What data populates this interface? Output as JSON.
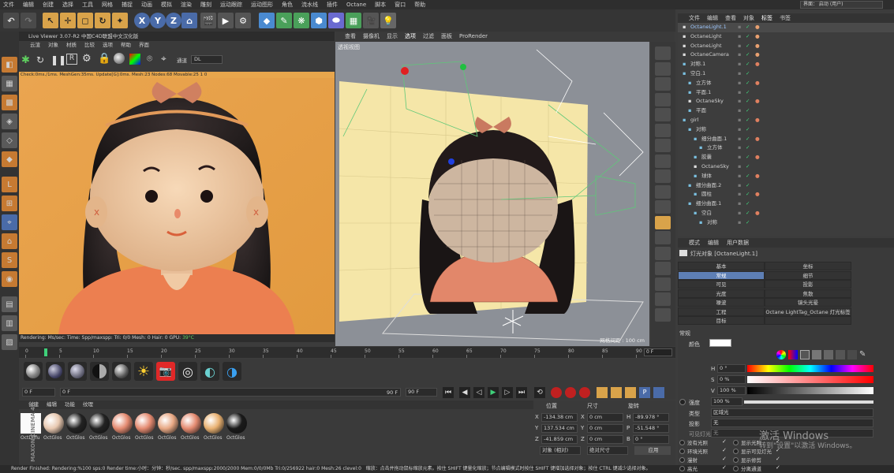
{
  "menu": [
    "文件",
    "编辑",
    "创建",
    "选择",
    "工具",
    "网格",
    "捕捉",
    "动画",
    "模拟",
    "渲染",
    "雕刻",
    "运动跟踪",
    "运动图形",
    "角色",
    "流水线",
    "插件",
    "Octane",
    "脚本",
    "窗口",
    "帮助"
  ],
  "layout_label": "界面：  启动 (用户)",
  "toolbar": {
    "x": "X",
    "y": "Y",
    "z": "Z"
  },
  "live_viewer": {
    "title": "Live Viewer 3.07-R2 中国C4D联盟中文汉化版",
    "menu": [
      "云渲",
      "对象",
      "材质",
      "比较",
      "选项",
      "帮助",
      "界面"
    ],
    "channel_label": "通道",
    "channel_value": "DL",
    "stats": "Check:0ms./1ms. MeshGen:35ms. Update[G]:0ms. Mesh:23 Nodes:68 Movable:25 1 0",
    "status": "Rendering:    Ms/sec:     Time:      Spp/maxspp:      Tri: 0/0  Mesh: 0    Hair: 0    GPU:",
    "gpu_temp": "39°C"
  },
  "viewport": {
    "menu": [
      "查看",
      "摄像机",
      "显示",
      "选项",
      "过滤",
      "面板",
      "ProRender"
    ],
    "label": "透视视图",
    "grid_spacing": "网格间距 : 100 cm"
  },
  "timeline": {
    "ticks": [
      "0",
      "5",
      "10",
      "15",
      "20",
      "25",
      "30",
      "35",
      "40",
      "45",
      "50",
      "55",
      "60",
      "65",
      "70",
      "75",
      "80",
      "85",
      "90"
    ],
    "end_frame": "0 F"
  },
  "controls": {
    "start": "0 F",
    "current": "0 F",
    "end": "90 F",
    "end2": "90 F"
  },
  "material_panel": {
    "tabs": [
      "创建",
      "编辑",
      "功能",
      "纹理"
    ],
    "materials": [
      "OctDiffu",
      "OctGlos",
      "OctGlos",
      "OctGlos",
      "OctGlos",
      "OctGlos",
      "OctGlos",
      "OctGlos",
      "OctGlos",
      "OctGlos"
    ],
    "brand1": "MAXON",
    "brand2": "CINEMA 4D"
  },
  "coords": {
    "headers": [
      "位置",
      "尺寸",
      "旋转"
    ],
    "rows": [
      [
        "X",
        "-134.38 cm",
        "X",
        "0 cm",
        "H",
        "-89.978 °"
      ],
      [
        "Y",
        "137.534 cm",
        "Y",
        "0 cm",
        "P",
        "-51.548 °"
      ],
      [
        "Z",
        "-41.859 cm",
        "Z",
        "0 cm",
        "B",
        "0 °"
      ]
    ],
    "obj_mode": "对象 (相对)",
    "size_mode": "绝对尺寸",
    "apply": "应用"
  },
  "object_tabs": [
    "文件",
    "编辑",
    "查看",
    "对象",
    "标签",
    "书签"
  ],
  "objects": [
    {
      "name": "OctaneLight.1",
      "indent": 0,
      "sel": true
    },
    {
      "name": "OctaneLight",
      "indent": 0
    },
    {
      "name": "OctaneLight",
      "indent": 0
    },
    {
      "name": "OctaneCamera",
      "indent": 0
    },
    {
      "name": "对称.1",
      "indent": 0
    },
    {
      "name": "空白.1",
      "indent": 0
    },
    {
      "name": "立方体",
      "indent": 1
    },
    {
      "name": "平面.1",
      "indent": 1
    },
    {
      "name": "OctaneSky",
      "indent": 1
    },
    {
      "name": "平面",
      "indent": 1
    },
    {
      "name": "girl",
      "indent": 0
    },
    {
      "name": "对称",
      "indent": 1
    },
    {
      "name": "细分曲面.1",
      "indent": 2
    },
    {
      "name": "立方体",
      "indent": 3
    },
    {
      "name": "胶囊",
      "indent": 2
    },
    {
      "name": "OctaneSky",
      "indent": 2
    },
    {
      "name": "球体",
      "indent": 2
    },
    {
      "name": "细分曲面.2",
      "indent": 1
    },
    {
      "name": "圆柱",
      "indent": 2
    },
    {
      "name": "细分曲面.1",
      "indent": 1
    },
    {
      "name": "空白",
      "indent": 2
    },
    {
      "name": "对称",
      "indent": 3
    }
  ],
  "attr_tabs": [
    "模式",
    "编辑",
    "用户数据"
  ],
  "attr_title": "灯光对象 [OctaneLight.1]",
  "attr_grid": [
    [
      "基本",
      "坐标"
    ],
    [
      "常规",
      "细节"
    ],
    [
      "可见",
      "投影"
    ],
    [
      "光度",
      "焦散"
    ],
    [
      "噪波",
      "镜头光晕"
    ],
    [
      "工程",
      "Octane LightTag_Octane 灯光标签"
    ],
    [
      "目标",
      ""
    ]
  ],
  "attr": {
    "section": "常规",
    "color_label": "颜色",
    "h_label": "H",
    "h_val": "0 °",
    "s_label": "S",
    "s_val": "0 %",
    "v_label": "V",
    "v_val": "100 %",
    "intensity_label": "强度",
    "intensity_val": "100 %",
    "type_label": "类型",
    "type_val": "区域光",
    "shadow_label": "投影",
    "shadow_val": "无",
    "visible_label": "可见灯光",
    "visible_val": "无",
    "opts": [
      "没有光照",
      "显示光照",
      "环境光照",
      "显示可见灯光",
      "漫射",
      "显示修剪",
      "高光",
      "分离通道"
    ]
  },
  "watermark": [
    "激活 Windows",
    "转到\"设置\"以激活 Windows。"
  ],
  "bottom_status": "Render Finished: Rendering:%100 sps:0 Render time:小时：分钟：秒/sec. spp/maxspp:2000/2000 Mem:0/0/0Mb Tri:0/256922 hair:0 Mesh:26 clevel:0",
  "bottom_hint": "缩放：点击并拖动鼠标缩放元素。按住 SHIFT 键量化缩放；节点编辑模式时按住 SHIFT 键增加选择对象；按住 CTRL 键减少选择对象。",
  "colors": {
    "bg": "#3c3c3c",
    "accent": "#d9a34a",
    "select": "#5e7fb5"
  }
}
